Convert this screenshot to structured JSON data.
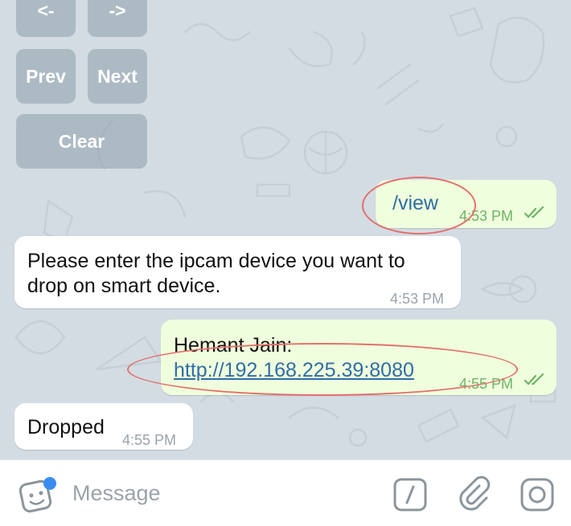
{
  "keyboard": {
    "buttons": [
      {
        "label": "<-"
      },
      {
        "label": "->"
      },
      {
        "label": "Prev"
      },
      {
        "label": "Next"
      },
      {
        "label": "Clear"
      }
    ]
  },
  "messages": [
    {
      "direction": "out",
      "text": "/view",
      "time": "4:53 PM",
      "status": "read"
    },
    {
      "direction": "in",
      "text_line1": "Please enter the ipcam device you want to",
      "text_line2": "drop on smart device.",
      "time": "4:53 PM"
    },
    {
      "direction": "out",
      "name": "Hemant Jain:",
      "link": "http://192.168.225.39:8080",
      "time": "4:55 PM",
      "status": "read"
    },
    {
      "direction": "in",
      "text": "Dropped",
      "time": "4:55 PM"
    }
  ],
  "composer": {
    "placeholder": "Message",
    "sticker_icon": "sticker-icon",
    "command_icon": "slash-command-icon",
    "attach_icon": "paperclip-icon",
    "camera_icon": "camera-icon"
  },
  "colors": {
    "wallpaper": "#d3dce3",
    "incoming_bubble": "#ffffff",
    "outgoing_bubble": "#effedd",
    "link": "#2f6ea5",
    "outgoing_time": "#6db566",
    "annotation": "#e2706d",
    "badge": "#3a8df0"
  }
}
